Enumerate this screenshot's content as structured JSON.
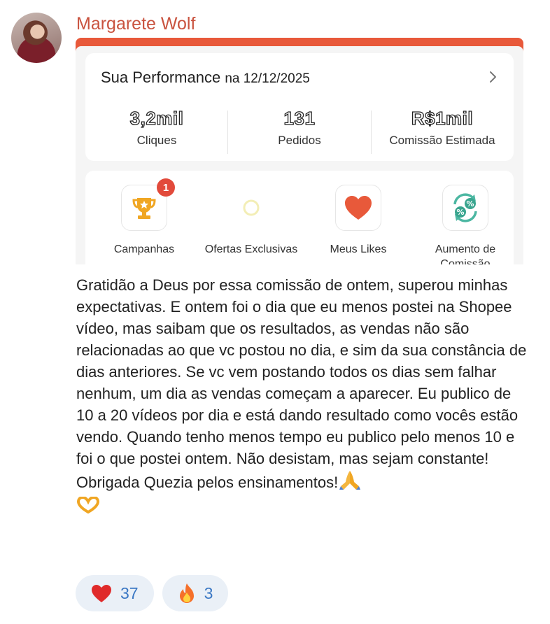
{
  "author": {
    "name": "Margarete Wolf"
  },
  "performance": {
    "title": "Sua Performance",
    "date_label": "na 12/12/2025",
    "stats": [
      {
        "value": "3,2mil",
        "label": "Cliques"
      },
      {
        "value": "131",
        "label": "Pedidos"
      },
      {
        "value": "R$1mil",
        "label": "Comissão Estimada"
      }
    ]
  },
  "tools": [
    {
      "label": "Campanhas",
      "icon": "trophy-icon",
      "badge": "1"
    },
    {
      "label": "Ofertas Exclusivas",
      "icon": "loading-ring-icon"
    },
    {
      "label": "Meus Likes",
      "icon": "heart-icon"
    },
    {
      "label": "Aumento de Comissão",
      "icon": "percent-cycle-icon"
    }
  ],
  "message": {
    "text": "Gratidão a Deus por essa comissão de ontem, superou minhas expectativas. E ontem foi o dia que eu menos postei na Shopee vídeo, mas saibam que os resultados, as vendas não são relacionadas ao que vc postou no dia, e sim da sua constância de dias anteriores. Se vc vem postando todos os dias sem falhar nenhum, um dia as vendas começam a aparecer. Eu publico de 10 a 20 vídeos por dia e está dando resultado como vocês estão vendo. Quando tenho menos tempo eu publico pelo menos 10 e foi o que postei ontem. Não desistam, mas sejam constante! Obrigada Quezia pelos ensinamentos!",
    "emojis": [
      "praying-hands-icon",
      "heart-hands-icon"
    ]
  },
  "reactions": [
    {
      "icon": "red-heart-icon",
      "count": "37"
    },
    {
      "icon": "fire-icon",
      "count": "3"
    }
  ],
  "colors": {
    "author": "#c9533f",
    "accent": "#e8593a",
    "reaction_bg": "#eaf0f7",
    "reaction_text": "#3b78c4"
  }
}
